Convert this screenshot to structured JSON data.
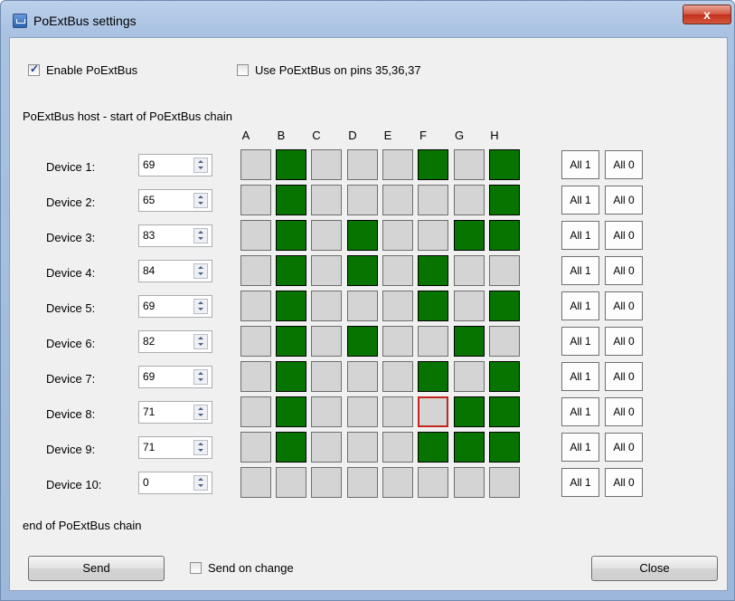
{
  "window": {
    "title": "PoExtBus settings",
    "close_label": "x"
  },
  "checkboxes": {
    "enable": {
      "label": "Enable PoExtBus",
      "checked": true
    },
    "pins": {
      "label": "Use PoExtBus on pins 35,36,37",
      "checked": false
    },
    "send_on_change": {
      "label": "Send on change",
      "checked": false
    }
  },
  "labels": {
    "chain_start": "PoExtBus host - start of PoExtBus chain",
    "chain_end": "end of PoExtBus chain"
  },
  "columns": [
    "A",
    "B",
    "C",
    "D",
    "E",
    "F",
    "G",
    "H"
  ],
  "devices": [
    {
      "label": "Device 1:",
      "value": "69",
      "bits": [
        0,
        1,
        0,
        0,
        0,
        1,
        0,
        1
      ]
    },
    {
      "label": "Device 2:",
      "value": "65",
      "bits": [
        0,
        1,
        0,
        0,
        0,
        0,
        0,
        1
      ]
    },
    {
      "label": "Device 3:",
      "value": "83",
      "bits": [
        0,
        1,
        0,
        1,
        0,
        0,
        1,
        1
      ]
    },
    {
      "label": "Device 4:",
      "value": "84",
      "bits": [
        0,
        1,
        0,
        1,
        0,
        1,
        0,
        0
      ]
    },
    {
      "label": "Device 5:",
      "value": "69",
      "bits": [
        0,
        1,
        0,
        0,
        0,
        1,
        0,
        1
      ]
    },
    {
      "label": "Device 6:",
      "value": "82",
      "bits": [
        0,
        1,
        0,
        1,
        0,
        0,
        1,
        0
      ]
    },
    {
      "label": "Device 7:",
      "value": "69",
      "bits": [
        0,
        1,
        0,
        0,
        0,
        1,
        0,
        1
      ]
    },
    {
      "label": "Device 8:",
      "value": "71",
      "bits": [
        0,
        1,
        0,
        0,
        0,
        0,
        1,
        1
      ]
    },
    {
      "label": "Device 9:",
      "value": "71",
      "bits": [
        0,
        1,
        0,
        0,
        0,
        1,
        1,
        1
      ]
    },
    {
      "label": "Device 10:",
      "value": "0",
      "bits": [
        0,
        0,
        0,
        0,
        0,
        0,
        0,
        0
      ]
    }
  ],
  "row_buttons": {
    "all1": "All 1",
    "all0": "All 0"
  },
  "buttons": {
    "send": "Send",
    "close": "Close"
  },
  "colors": {
    "on": "#077400",
    "off": "#d4d4d4",
    "focus": "#c1261c"
  },
  "icons": {
    "window": "app-icon",
    "spin": "spinner-arrows-icon"
  }
}
